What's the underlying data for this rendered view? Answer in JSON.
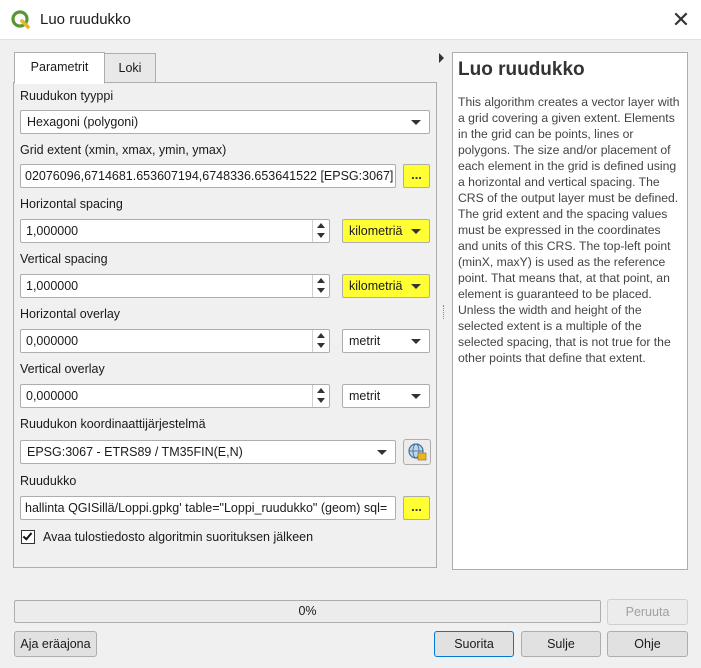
{
  "window": {
    "title": "Luo ruudukko"
  },
  "tabs": [
    {
      "label": "Parametrit"
    },
    {
      "label": "Loki"
    }
  ],
  "params": {
    "grid_type": {
      "label": "Ruudukon tyyppi",
      "value": "Hexagoni (polygoni)"
    },
    "extent": {
      "label": "Grid extent (xmin, xmax, ymin, ymax)",
      "value": "02076096,6714681.653607194,6748336.653641522 [EPSG:3067]",
      "button": "..."
    },
    "h_spacing": {
      "label": "Horizontal spacing",
      "value": "1,000000",
      "unit": "kilometriä"
    },
    "v_spacing": {
      "label": "Vertical spacing",
      "value": "1,000000",
      "unit": "kilometriä"
    },
    "h_overlay": {
      "label": "Horizontal overlay",
      "value": "0,000000",
      "unit": "metrit"
    },
    "v_overlay": {
      "label": "Vertical overlay",
      "value": "0,000000",
      "unit": "metrit"
    },
    "crs": {
      "label": "Ruudukon koordinaattijärjestelmä",
      "value": "EPSG:3067 - ETRS89 / TM35FIN(E,N)"
    },
    "output": {
      "label": "Ruudukko",
      "value": "hallinta QGISillä/Loppi.gpkg' table=\"Loppi_ruudukko\" (geom) sql=",
      "button": "..."
    },
    "open_output": {
      "label": "Avaa tulostiedosto algoritmin suorituksen jälkeen",
      "checked": true
    }
  },
  "help": {
    "title": "Luo ruudukko",
    "text": "This algorithm creates a vector layer with a grid covering a given extent. Elements in the grid can be points, lines or polygons. The size and/or placement of each element in the grid is defined using a horizontal and vertical spacing. The CRS of the output layer must be defined. The grid extent and the spacing values must be expressed in the coordinates and units of this CRS. The top-left point (minX, maxY) is used as the reference point. That means that, at that point, an element is guaranteed to be placed. Unless the width and height of the selected extent is a multiple of the selected spacing, that is not true for the other points that define that extent."
  },
  "progress": {
    "text": "0%",
    "value": 0
  },
  "buttons": {
    "cancel": "Peruuta",
    "batch": "Aja eräajona",
    "run": "Suorita",
    "close": "Sulje",
    "help": "Ohje"
  },
  "colors": {
    "highlight": "#ffff33",
    "qgis_green": "#589632",
    "qgis_yellow": "#eeb422"
  }
}
